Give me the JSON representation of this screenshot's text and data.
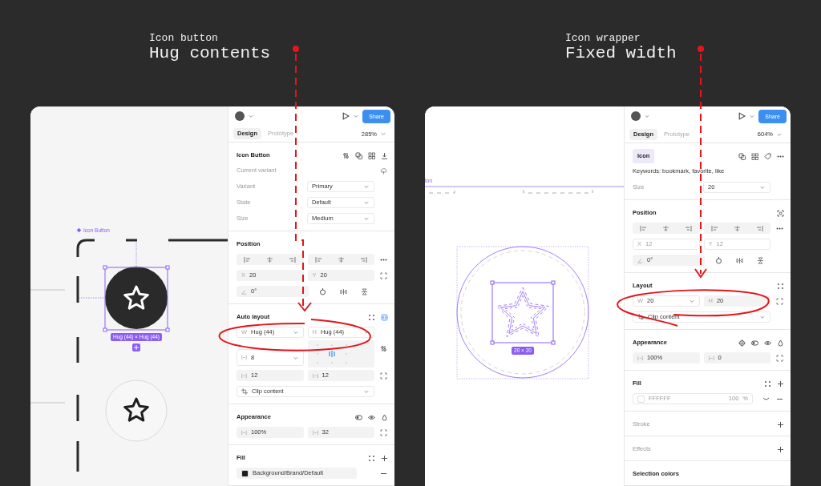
{
  "boards": [
    {
      "annotation": {
        "caption": "Icon button",
        "title": "Hug contents"
      },
      "canvas": {
        "kind": "icon_button",
        "frame_label": "Icon Button",
        "size_badge": "Hug (44) × Hug (44)"
      },
      "inspector": {
        "share": "Share",
        "zoom": "285%",
        "tabs": [
          {
            "label": "Design",
            "selected": true
          },
          {
            "label": "Prototype",
            "selected": false
          }
        ],
        "sections": [
          {
            "kind": "component",
            "title": "Icon Button",
            "badge": false,
            "muted": false,
            "rows": [
              {
                "kind": "note",
                "text": "Current variant"
              },
              {
                "kind": "select",
                "label": "Variant",
                "value": "Primary"
              },
              {
                "kind": "select",
                "label": "State",
                "value": "Default"
              },
              {
                "kind": "select",
                "label": "Size",
                "value": "Medium"
              }
            ]
          },
          {
            "kind": "position",
            "title": "Position",
            "badge": false,
            "muted": false,
            "rows": [
              {
                "kind": "align"
              },
              {
                "kind": "pair",
                "side_icon": true,
                "fields": [
                  {
                    "prefix": "X",
                    "value": "20",
                    "dropdown": false,
                    "disabled": false
                  },
                  {
                    "prefix": "Y",
                    "value": "20",
                    "dropdown": false,
                    "disabled": false
                  }
                ]
              },
              {
                "kind": "rotation",
                "value": "0°"
              }
            ]
          },
          {
            "kind": "auto_layout",
            "title": "Auto layout",
            "badge": false,
            "muted": false,
            "rows": [
              {
                "kind": "pair",
                "side_icon": false,
                "fields": [
                  {
                    "prefix": "W",
                    "value": "Hug (44)",
                    "dropdown": true,
                    "disabled": false
                  },
                  {
                    "prefix": "H",
                    "value": "Hug (44)",
                    "dropdown": true,
                    "disabled": false
                  }
                ]
              },
              {
                "kind": "gap",
                "value": "8"
              },
              {
                "kind": "pair",
                "side_icon": true,
                "fields": [
                  {
                    "value": "12",
                    "dropdown": false,
                    "disabled": false
                  },
                  {
                    "value": "12",
                    "dropdown": false,
                    "disabled": false
                  }
                ]
              },
              {
                "kind": "clip",
                "value": "Clip content"
              }
            ]
          },
          {
            "kind": "appearance",
            "title": "Appearance",
            "badge": false,
            "muted": false,
            "rows": [
              {
                "kind": "pair",
                "side_icon": true,
                "fields": [
                  {
                    "value": "100%",
                    "dropdown": false,
                    "disabled": false
                  },
                  {
                    "value": "32",
                    "dropdown": false,
                    "disabled": false
                  }
                ]
              }
            ]
          },
          {
            "kind": "fill",
            "title": "Fill",
            "badge": false,
            "muted": false,
            "rows": [
              {
                "kind": "fill",
                "color": "#1e1e1e",
                "value": "Background/Brand/Default",
                "disabled": false
              }
            ]
          }
        ]
      }
    },
    {
      "annotation": {
        "caption": "Icon wrapper",
        "title": "Fixed width"
      },
      "canvas": {
        "kind": "icon_wrapper",
        "frame_label": "ton",
        "size_badge": "20 × 20"
      },
      "inspector": {
        "share": "Share",
        "zoom": "604%",
        "tabs": [
          {
            "label": "Design",
            "selected": true
          },
          {
            "label": "Prototype",
            "selected": false
          }
        ],
        "sections": [
          {
            "kind": "icon",
            "title": "Icon",
            "badge": true,
            "muted": false,
            "rows": [
              {
                "kind": "text",
                "text": "Keywords: bookmark, favorite, like"
              },
              {
                "kind": "select",
                "label": "Size",
                "value": "20"
              }
            ]
          },
          {
            "kind": "position_focus",
            "title": "Position",
            "badge": false,
            "muted": false,
            "rows": [
              {
                "kind": "align"
              },
              {
                "kind": "pair",
                "side_icon": false,
                "fields": [
                  {
                    "prefix": "X",
                    "value": "12",
                    "dropdown": false,
                    "disabled": true
                  },
                  {
                    "prefix": "Y",
                    "value": "12",
                    "dropdown": false,
                    "disabled": true
                  }
                ]
              },
              {
                "kind": "rotation",
                "value": "0°"
              }
            ]
          },
          {
            "kind": "layout",
            "title": "Layout",
            "badge": false,
            "muted": false,
            "rows": [
              {
                "kind": "pair",
                "side_icon": true,
                "fields": [
                  {
                    "prefix": "W",
                    "value": "20",
                    "dropdown": true,
                    "disabled": false
                  },
                  {
                    "prefix": "H",
                    "value": "20",
                    "dropdown": false,
                    "disabled": false
                  }
                ]
              },
              {
                "kind": "clip",
                "value": "Clip content"
              }
            ]
          },
          {
            "kind": "appearance_var",
            "title": "Appearance",
            "badge": false,
            "muted": false,
            "rows": [
              {
                "kind": "pair",
                "side_icon": true,
                "fields": [
                  {
                    "value": "100%",
                    "dropdown": false,
                    "disabled": false
                  },
                  {
                    "value": "0",
                    "dropdown": false,
                    "disabled": false
                  }
                ]
              }
            ]
          },
          {
            "kind": "fill",
            "title": "Fill",
            "badge": false,
            "muted": false,
            "rows": [
              {
                "kind": "fill",
                "color": "#ffffff",
                "value": "FFFFFF",
                "opacity": "100",
                "unit": "%",
                "disabled": true
              }
            ]
          },
          {
            "kind": "stroke",
            "title": "Stroke",
            "badge": false,
            "muted": true
          },
          {
            "kind": "effects",
            "title": "Effects",
            "badge": false,
            "muted": true
          },
          {
            "kind": "selection",
            "title": "Selection colors",
            "badge": false,
            "muted": false
          }
        ]
      }
    }
  ]
}
